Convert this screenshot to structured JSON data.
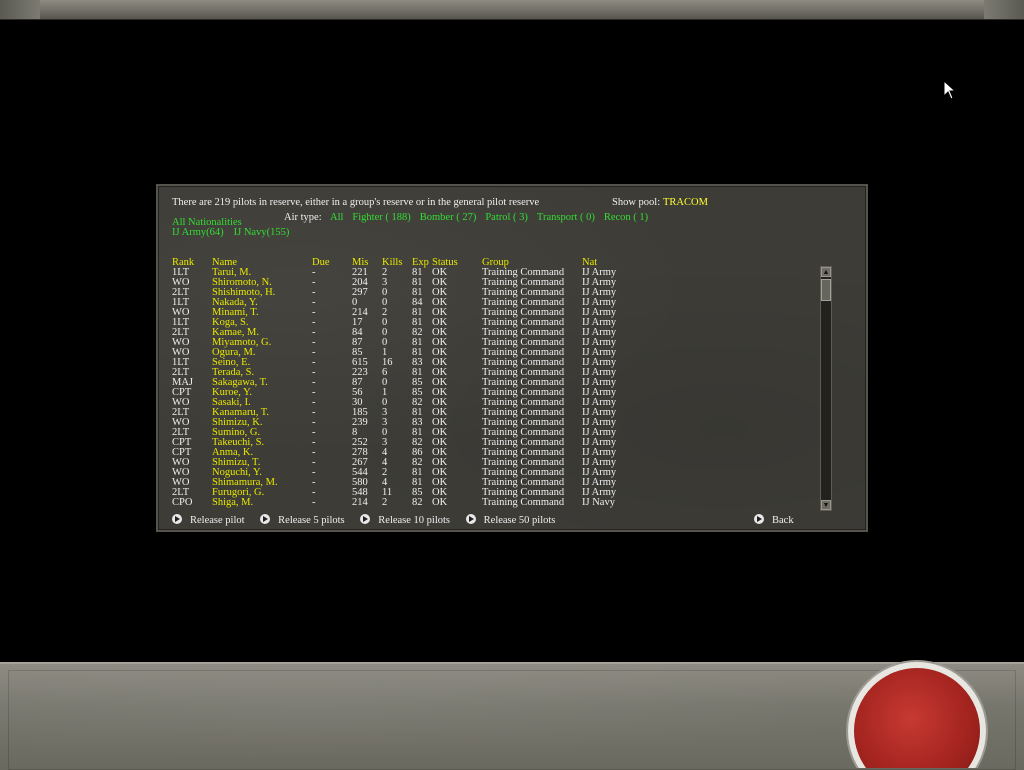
{
  "reserve": {
    "summary": "There are 219 pilots in reserve, either in a group's reserve or in the general pilot reserve",
    "show_pool_label": "Show pool:",
    "show_pool_value": "TRACOM"
  },
  "filters": {
    "all_nationalities": "All Nationalities",
    "nationalities": [
      "IJ Army(64)",
      "IJ Navy(155)"
    ],
    "air_type_label": "Air type:",
    "air_types": [
      "All",
      "Fighter ( 188)",
      "Bomber ( 27)",
      "Patrol ( 3)",
      "Transport ( 0)",
      "Recon ( 1)"
    ]
  },
  "table": {
    "headers": {
      "rank": "Rank",
      "name": "Name",
      "due": "Due",
      "mis": "Mis",
      "kills": "Kills",
      "exp": "Exp",
      "status": "Status",
      "group": "Group",
      "nat": "Nat"
    },
    "rows": [
      {
        "rank": "1LT",
        "name": "Tarui, M.",
        "due": "-",
        "mis": "221",
        "kills": "2",
        "exp": "81",
        "status": "OK",
        "group": "Training Command",
        "nat": "IJ Army"
      },
      {
        "rank": "WO",
        "name": "Shiromoto, N.",
        "due": "-",
        "mis": "204",
        "kills": "3",
        "exp": "81",
        "status": "OK",
        "group": "Training Command",
        "nat": "IJ Army"
      },
      {
        "rank": "2LT",
        "name": "Shishimoto, H.",
        "due": "-",
        "mis": "297",
        "kills": "0",
        "exp": "81",
        "status": "OK",
        "group": "Training Command",
        "nat": "IJ Army"
      },
      {
        "rank": "1LT",
        "name": "Nakada, Y.",
        "due": "-",
        "mis": "0",
        "kills": "0",
        "exp": "84",
        "status": "OK",
        "group": "Training Command",
        "nat": "IJ Army"
      },
      {
        "rank": "WO",
        "name": "Minami, T.",
        "due": "-",
        "mis": "214",
        "kills": "2",
        "exp": "81",
        "status": "OK",
        "group": "Training Command",
        "nat": "IJ Army"
      },
      {
        "rank": "1LT",
        "name": "Koga, S.",
        "due": "-",
        "mis": "17",
        "kills": "0",
        "exp": "81",
        "status": "OK",
        "group": "Training Command",
        "nat": "IJ Army"
      },
      {
        "rank": "2LT",
        "name": "Kamae, M.",
        "due": "-",
        "mis": "84",
        "kills": "0",
        "exp": "82",
        "status": "OK",
        "group": "Training Command",
        "nat": "IJ Army"
      },
      {
        "rank": "WO",
        "name": "Miyamoto, G.",
        "due": "-",
        "mis": "87",
        "kills": "0",
        "exp": "81",
        "status": "OK",
        "group": "Training Command",
        "nat": "IJ Army"
      },
      {
        "rank": "WO",
        "name": "Ogura, M.",
        "due": "-",
        "mis": "85",
        "kills": "1",
        "exp": "81",
        "status": "OK",
        "group": "Training Command",
        "nat": "IJ Army"
      },
      {
        "rank": "1LT",
        "name": "Seino, E.",
        "due": "-",
        "mis": "615",
        "kills": "16",
        "exp": "83",
        "status": "OK",
        "group": "Training Command",
        "nat": "IJ Army"
      },
      {
        "rank": "2LT",
        "name": "Terada, S.",
        "due": "-",
        "mis": "223",
        "kills": "6",
        "exp": "81",
        "status": "OK",
        "group": "Training Command",
        "nat": "IJ Army"
      },
      {
        "rank": "MAJ",
        "name": "Sakagawa, T.",
        "due": "-",
        "mis": "87",
        "kills": "0",
        "exp": "85",
        "status": "OK",
        "group": "Training Command",
        "nat": "IJ Army"
      },
      {
        "rank": "CPT",
        "name": "Kuroe, Y.",
        "due": "-",
        "mis": "56",
        "kills": "1",
        "exp": "85",
        "status": "OK",
        "group": "Training Command",
        "nat": "IJ Army"
      },
      {
        "rank": "WO",
        "name": "Sasaki, I.",
        "due": "-",
        "mis": "30",
        "kills": "0",
        "exp": "82",
        "status": "OK",
        "group": "Training Command",
        "nat": "IJ Army"
      },
      {
        "rank": "2LT",
        "name": "Kanamaru, T.",
        "due": "-",
        "mis": "185",
        "kills": "3",
        "exp": "81",
        "status": "OK",
        "group": "Training Command",
        "nat": "IJ Army"
      },
      {
        "rank": "WO",
        "name": "Shimizu, K.",
        "due": "-",
        "mis": "239",
        "kills": "3",
        "exp": "83",
        "status": "OK",
        "group": "Training Command",
        "nat": "IJ Army"
      },
      {
        "rank": "2LT",
        "name": "Sumino, G.",
        "due": "-",
        "mis": "8",
        "kills": "0",
        "exp": "81",
        "status": "OK",
        "group": "Training Command",
        "nat": "IJ Army"
      },
      {
        "rank": "CPT",
        "name": "Takeuchi, S.",
        "due": "-",
        "mis": "252",
        "kills": "3",
        "exp": "82",
        "status": "OK",
        "group": "Training Command",
        "nat": "IJ Army"
      },
      {
        "rank": "CPT",
        "name": "Anma, K.",
        "due": "-",
        "mis": "278",
        "kills": "4",
        "exp": "86",
        "status": "OK",
        "group": "Training Command",
        "nat": "IJ Army"
      },
      {
        "rank": "WO",
        "name": "Shimizu, T.",
        "due": "-",
        "mis": "267",
        "kills": "4",
        "exp": "82",
        "status": "OK",
        "group": "Training Command",
        "nat": "IJ Army"
      },
      {
        "rank": "WO",
        "name": "Noguchi, Y.",
        "due": "-",
        "mis": "544",
        "kills": "2",
        "exp": "81",
        "status": "OK",
        "group": "Training Command",
        "nat": "IJ Army"
      },
      {
        "rank": "WO",
        "name": "Shimamura, M.",
        "due": "-",
        "mis": "580",
        "kills": "4",
        "exp": "81",
        "status": "OK",
        "group": "Training Command",
        "nat": "IJ Army"
      },
      {
        "rank": "2LT",
        "name": "Furugori, G.",
        "due": "-",
        "mis": "548",
        "kills": "11",
        "exp": "85",
        "status": "OK",
        "group": "Training Command",
        "nat": "IJ Army"
      },
      {
        "rank": "CPO",
        "name": "Shiga, M.",
        "due": "-",
        "mis": "214",
        "kills": "2",
        "exp": "82",
        "status": "OK",
        "group": "Training Command",
        "nat": "IJ Navy"
      }
    ]
  },
  "actions": [
    "Release pilot",
    "Release 5 pilots",
    "Release 10 pilots",
    "Release 50 pilots"
  ],
  "back_label": "Back",
  "colors": {
    "link": "#33dd33",
    "highlight": "#e8e800",
    "panel": "#3d3c37"
  },
  "icons": [
    "arrow-right-icon",
    "scroll-up-icon",
    "scroll-down-icon",
    "mouse-cursor-icon"
  ]
}
